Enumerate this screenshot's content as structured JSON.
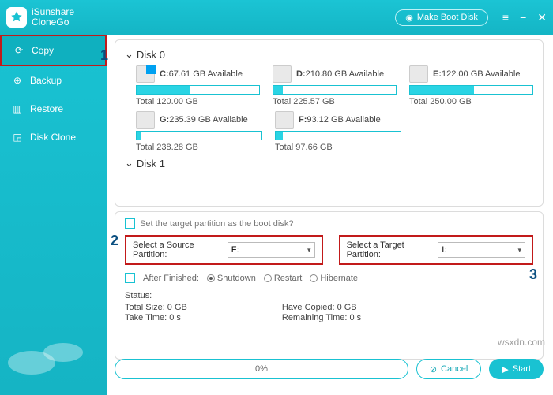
{
  "brand": {
    "line1": "iSunshare",
    "line2": "CloneGo"
  },
  "topbar": {
    "make_boot": "Make Boot Disk"
  },
  "sidebar": {
    "items": [
      {
        "label": "Copy"
      },
      {
        "label": "Backup"
      },
      {
        "label": "Restore"
      },
      {
        "label": "Disk Clone"
      }
    ]
  },
  "markers": {
    "m1": "1",
    "m2": "2",
    "m3": "3"
  },
  "disks": {
    "d0": {
      "title": "Disk 0",
      "parts": [
        {
          "letter": "C:",
          "avail": "67.61 GB Available",
          "total": "Total 120.00 GB",
          "fill": 44,
          "win": true
        },
        {
          "letter": "D:",
          "avail": "210.80 GB Available",
          "total": "Total 225.57 GB",
          "fill": 8
        },
        {
          "letter": "E:",
          "avail": "122.00 GB Available",
          "total": "Total 250.00 GB",
          "fill": 52
        },
        {
          "letter": "G:",
          "avail": "235.39 GB Available",
          "total": "Total 238.28 GB",
          "fill": 3
        },
        {
          "letter": "F:",
          "avail": "93.12 GB Available",
          "total": "Total 97.66 GB",
          "fill": 6
        }
      ]
    },
    "d1": {
      "title": "Disk 1"
    }
  },
  "panel2": {
    "boot_check": "Set the target partition as the boot disk?",
    "source_label": "Select a Source Partition:",
    "source_value": "F:",
    "target_label": "Select a Target Partition:",
    "target_value": "I:",
    "after_label": "After Finished:",
    "opts": {
      "shutdown": "Shutdown",
      "restart": "Restart",
      "hibernate": "Hibernate"
    },
    "status_title": "Status:",
    "total_size": "Total Size: 0 GB",
    "take_time": "Take Time: 0 s",
    "have_copied": "Have Copied: 0 GB",
    "remaining": "Remaining Time: 0 s"
  },
  "bottom": {
    "progress": "0%",
    "cancel": "Cancel",
    "start": "Start"
  },
  "watermark": "wsxdn.com"
}
